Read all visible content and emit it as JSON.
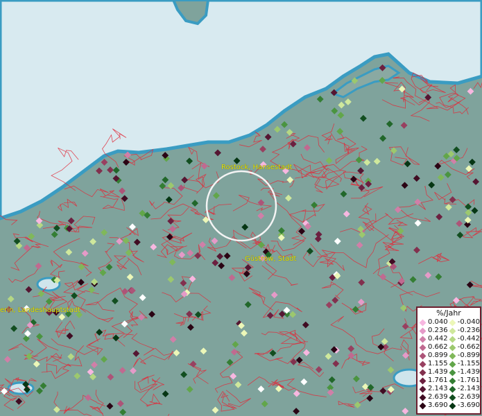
{
  "place_labels": {
    "rostock": "Rostock, Hansestadt",
    "guestrow": "Güstrow, Stadt",
    "schwerin": "erin, Landeshauptstadt"
  },
  "legend": {
    "title": "%/Jahr",
    "positive": [
      "0.040",
      "0.236",
      "0.442",
      "0.662",
      "0.899",
      "1.155",
      "1.439",
      "1.761",
      "2.143",
      "2.639",
      "3.690"
    ],
    "negative": [
      "-0.040",
      "-0.236",
      "-0.442",
      "-0.662",
      "-0.899",
      "-1.155",
      "-1.439",
      "-1.761",
      "-2.143",
      "-2.639",
      "-3.690"
    ],
    "positive_colors": [
      "#f7b7e0",
      "#e59ac8",
      "#d07fa8",
      "#c06a90",
      "#ad5478",
      "#984060",
      "#82304e",
      "#6c2040",
      "#551632",
      "#400c22",
      "#2a0414"
    ],
    "negative_colors": [
      "#ecf7b8",
      "#cfe89c",
      "#b5d884",
      "#9cc86e",
      "#80b85a",
      "#62a64a",
      "#4a9440",
      "#347e34",
      "#21672a",
      "#124e20",
      "#063614"
    ]
  },
  "colors": {
    "land": "#7fa39c",
    "sea": "#d5e9ef",
    "coast": "#3a9cc2",
    "boundary": "#e02a3a",
    "label": "#e8e800"
  }
}
